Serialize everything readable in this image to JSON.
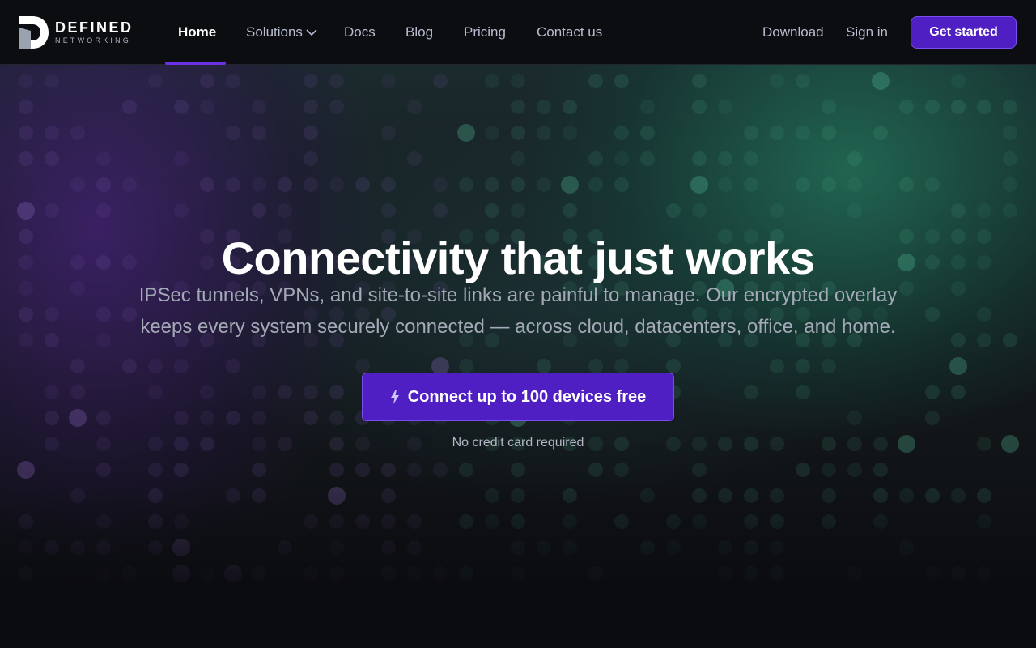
{
  "brand": {
    "name_top": "DEFINED",
    "name_bottom": "NETWORKING"
  },
  "nav": {
    "links": [
      {
        "label": "Home",
        "active": true
      },
      {
        "label": "Solutions",
        "dropdown": true
      },
      {
        "label": "Docs"
      },
      {
        "label": "Blog"
      },
      {
        "label": "Pricing"
      },
      {
        "label": "Contact us"
      }
    ],
    "right": {
      "download": "Download",
      "signin": "Sign in",
      "get_started": "Get started"
    }
  },
  "hero": {
    "title": "Connectivity that just works",
    "subtitle_line1": "IPSec tunnels, VPNs, and site-to-site links are painful to manage. Our encrypted overlay",
    "subtitle_line2": "keeps every system securely connected — across cloud, datacenters, office, and home.",
    "cta_label": "Connect up to 100 devices free",
    "cta_icon": "lightning-icon",
    "note": "No credit card required"
  },
  "colors": {
    "accent": "#4f1fc4",
    "accent_border": "#7a4bef",
    "nav_underline": "#6d32e8",
    "background": "#0b0c10"
  }
}
